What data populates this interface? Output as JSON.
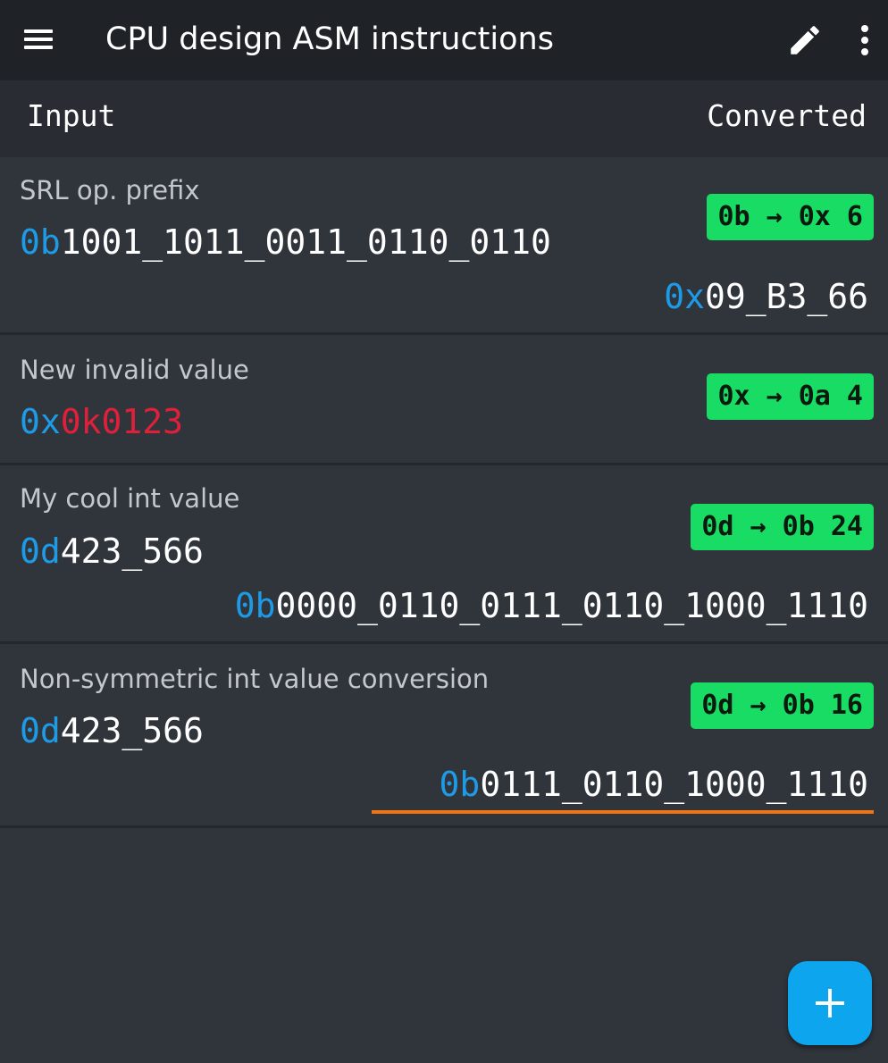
{
  "app_bar": {
    "title": "CPU design ASM instructions",
    "icons": [
      "menu-icon",
      "edit-icon",
      "more-vert-icon"
    ]
  },
  "header": {
    "input_label": "Input",
    "converted_label": "Converted"
  },
  "rows": [
    {
      "label": "SRL op. prefix",
      "input": {
        "prefix": "0b",
        "digits": "1001_1011_0011_0110_0110",
        "valid": true
      },
      "conversion": "0b → 0x 6",
      "output": {
        "prefix": "0x",
        "digits": "09_B3_66"
      }
    },
    {
      "label": "New invalid value",
      "input": {
        "prefix": "0x",
        "digits": "0k0123",
        "valid": false
      },
      "conversion": "0x → 0a 4",
      "output": null
    },
    {
      "label": "My cool int value",
      "input": {
        "prefix": "0d",
        "digits": "423_566",
        "valid": true
      },
      "conversion": "0d → 0b 24",
      "output": {
        "prefix": "0b",
        "digits": "0000_0110_0111_0110_1000_1110"
      }
    },
    {
      "label": "Non-symmetric int value conversion",
      "input": {
        "prefix": "0d",
        "digits": "423_566",
        "valid": true
      },
      "conversion": "0d → 0b 16",
      "output": {
        "prefix": "0b",
        "digits": "0111_0110_1000_1110",
        "highlighted": true
      }
    }
  ],
  "fab": {
    "icon": "add-icon"
  },
  "colors": {
    "app_bar_bg": "#1f2328",
    "header_bg": "#292d33",
    "page_bg": "#30353c",
    "prefix": "#1e9be6",
    "invalid": "#e0203a",
    "badge_bg": "#19dc64",
    "warning_underline": "#f07414",
    "fab_bg": "#0ea5ef"
  }
}
